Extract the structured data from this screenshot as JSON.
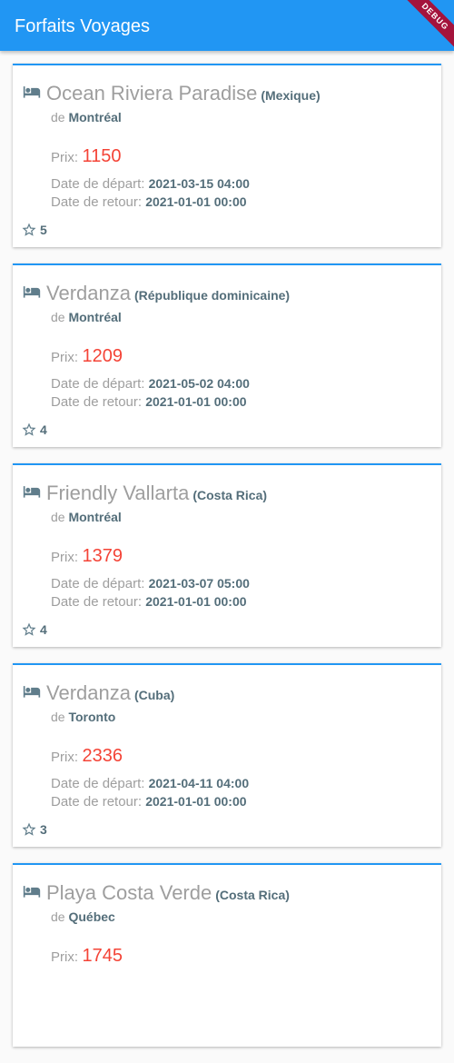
{
  "appbar": {
    "title": "Forfaits Voyages",
    "debug_label": "DEBUG",
    "color": "#2196f3"
  },
  "labels": {
    "from": "de",
    "price": "Prix:",
    "departure": "Date de départ:",
    "return": "Date de retour:"
  },
  "icons": {
    "hotel": "hotel-icon",
    "star": "star-outline-icon"
  },
  "colors": {
    "accent": "#2196f3",
    "price": "#f44336",
    "muted_text": "#9e9e9e",
    "value_text": "#546e7a"
  },
  "packages": [
    {
      "hotel": "Ocean Riviera Paradise",
      "country": "(Mexique)",
      "city": "Montréal",
      "price": "1150",
      "departure": "2021-03-15 04:00",
      "return": "2021-01-01 00:00",
      "rating": "5"
    },
    {
      "hotel": "Verdanza",
      "country": "(République dominicaine)",
      "city": "Montréal",
      "price": "1209",
      "departure": "2021-05-02 04:00",
      "return": "2021-01-01 00:00",
      "rating": "4"
    },
    {
      "hotel": "Friendly Vallarta",
      "country": "(Costa Rica)",
      "city": "Montréal",
      "price": "1379",
      "departure": "2021-03-07 05:00",
      "return": "2021-01-01 00:00",
      "rating": "4"
    },
    {
      "hotel": "Verdanza",
      "country": "(Cuba)",
      "city": "Toronto",
      "price": "2336",
      "departure": "2021-04-11 04:00",
      "return": "2021-01-01 00:00",
      "rating": "3"
    },
    {
      "hotel": "Playa Costa Verde",
      "country": "(Costa Rica)",
      "city": "Québec",
      "price": "1745",
      "departure": "",
      "return": "",
      "rating": ""
    }
  ]
}
